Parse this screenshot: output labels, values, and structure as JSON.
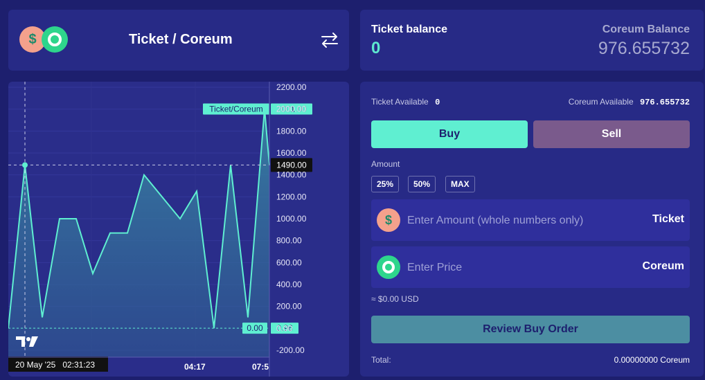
{
  "pair": {
    "title": "Ticket / Coreum",
    "swap_icon": "swap-arrows-icon"
  },
  "balances": {
    "ticket_label": "Ticket balance",
    "ticket_value": "0",
    "coreum_label": "Coreum Balance",
    "coreum_value": "976.655732"
  },
  "order": {
    "ticket_available_label": "Ticket Available",
    "ticket_available_value": "0",
    "coreum_available_label": "Coreum Available",
    "coreum_available_value": "976.655732",
    "buy_label": "Buy",
    "sell_label": "Sell",
    "amount_label": "Amount",
    "percent_buttons": [
      "25%",
      "50%",
      "MAX"
    ],
    "amount_placeholder": "Enter Amount (whole numbers only)",
    "amount_unit": "Ticket",
    "price_placeholder": "Enter Price",
    "price_unit": "Coreum",
    "usd_estimate": "≈ $0.00 USD",
    "review_label": "Review Buy Order",
    "total_label": "Total:",
    "total_value": "0.00000000 Coreum"
  },
  "colors": {
    "accent": "#5fefd1",
    "sell": "#7a5a8c",
    "panel": "#272a86",
    "background": "#1d1f6e"
  },
  "chart_data": {
    "type": "area",
    "series": [
      {
        "name": "Ticket/Coreum",
        "values": [
          0.96,
          1490,
          100,
          1000,
          1000,
          500,
          870,
          870,
          1400,
          1000,
          1250,
          0.96,
          1490,
          100,
          2001,
          1490
        ]
      }
    ],
    "ylim": [
      -200,
      2200
    ],
    "y_ticks": [
      "2200.00",
      "2000.00",
      "1800.00",
      "1600.00",
      "1400.00",
      "1200.00",
      "1000.00",
      "800.00",
      "600.00",
      "400.00",
      "200.00",
      "0.00",
      "-200.00"
    ],
    "x_ticks": [
      "04:17",
      "07:5"
    ],
    "crosshair_time": "20 May '25   02:31:23",
    "crosshair_value": "1490.00",
    "last_value": "2001.00",
    "series_tag": "Ticket/Coreum",
    "low_tag": "0.00",
    "low_value": "0.96",
    "logo_icon": "tradingview-logo-icon"
  }
}
